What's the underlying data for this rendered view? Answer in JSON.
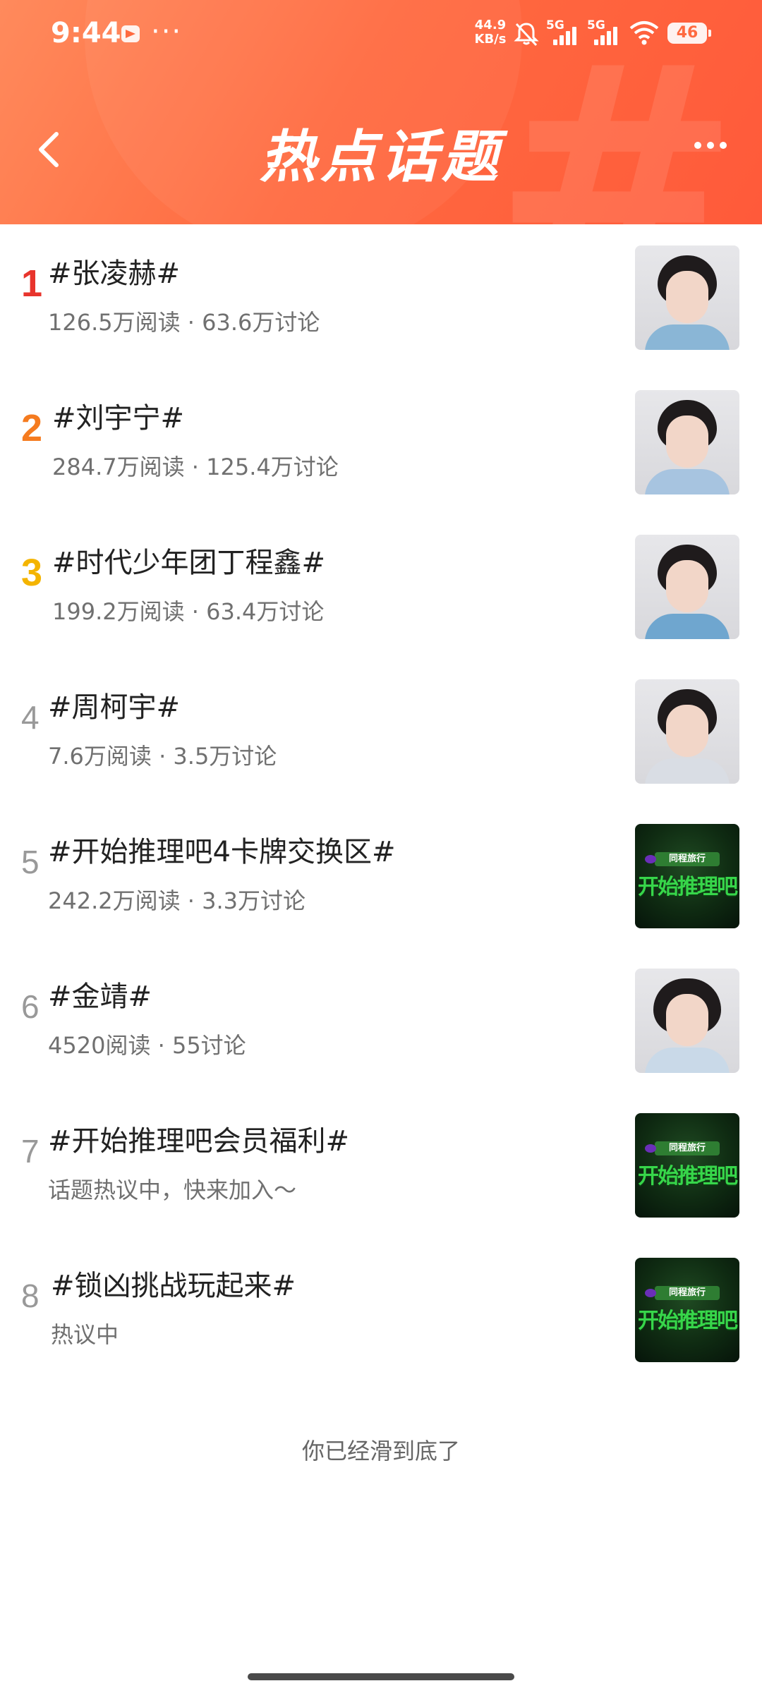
{
  "status_bar": {
    "time": "9:44",
    "more": "···",
    "net_speed_value": "44.9",
    "net_speed_unit": "KB/s",
    "sim1_label": "5G",
    "sim2_label": "5G",
    "battery": "46",
    "icons": [
      "telegram-icon",
      "bell-muted-icon",
      "signal-icon",
      "wifi-icon",
      "battery-icon"
    ]
  },
  "header": {
    "title": "热点话题",
    "back_icon": "chevron-left-icon",
    "more_icon": "more-dots-icon",
    "background_color": "#ff6a40"
  },
  "topics": [
    {
      "rank": "1",
      "title": "#张凌赫#",
      "meta": "126.5万阅读 · 63.6万讨论",
      "thumb": "person"
    },
    {
      "rank": "2",
      "title": "#刘宇宁#",
      "meta": "284.7万阅读 · 125.4万讨论",
      "thumb": "person"
    },
    {
      "rank": "3",
      "title": "#时代少年团丁程鑫#",
      "meta": "199.2万阅读 · 63.4万讨论",
      "thumb": "person"
    },
    {
      "rank": "4",
      "title": "#周柯宇#",
      "meta": "7.6万阅读 · 3.5万讨论",
      "thumb": "person"
    },
    {
      "rank": "5",
      "title": "#开始推理吧4卡牌交换区#",
      "meta": "242.2万阅读 · 3.3万讨论",
      "thumb": "game",
      "thumb_brand": "同程旅行",
      "thumb_title": "开始推理吧"
    },
    {
      "rank": "6",
      "title": "#金靖#",
      "meta": "4520阅读 · 55讨论",
      "thumb": "person"
    },
    {
      "rank": "7",
      "title": "#开始推理吧会员福利#",
      "meta": "话题热议中，快来加入～",
      "thumb": "game",
      "thumb_brand": "同程旅行",
      "thumb_title": "开始推理吧"
    },
    {
      "rank": "8",
      "title": "#锁凶挑战玩起来#",
      "meta": "热议中",
      "thumb": "game",
      "thumb_brand": "同程旅行",
      "thumb_title": "开始推理吧"
    }
  ],
  "rank_colors": {
    "1": "#e8342c",
    "2": "#f57b1f",
    "3": "#f4b400",
    "other": "#999999"
  },
  "footer": {
    "end_text": "你已经滑到底了"
  }
}
